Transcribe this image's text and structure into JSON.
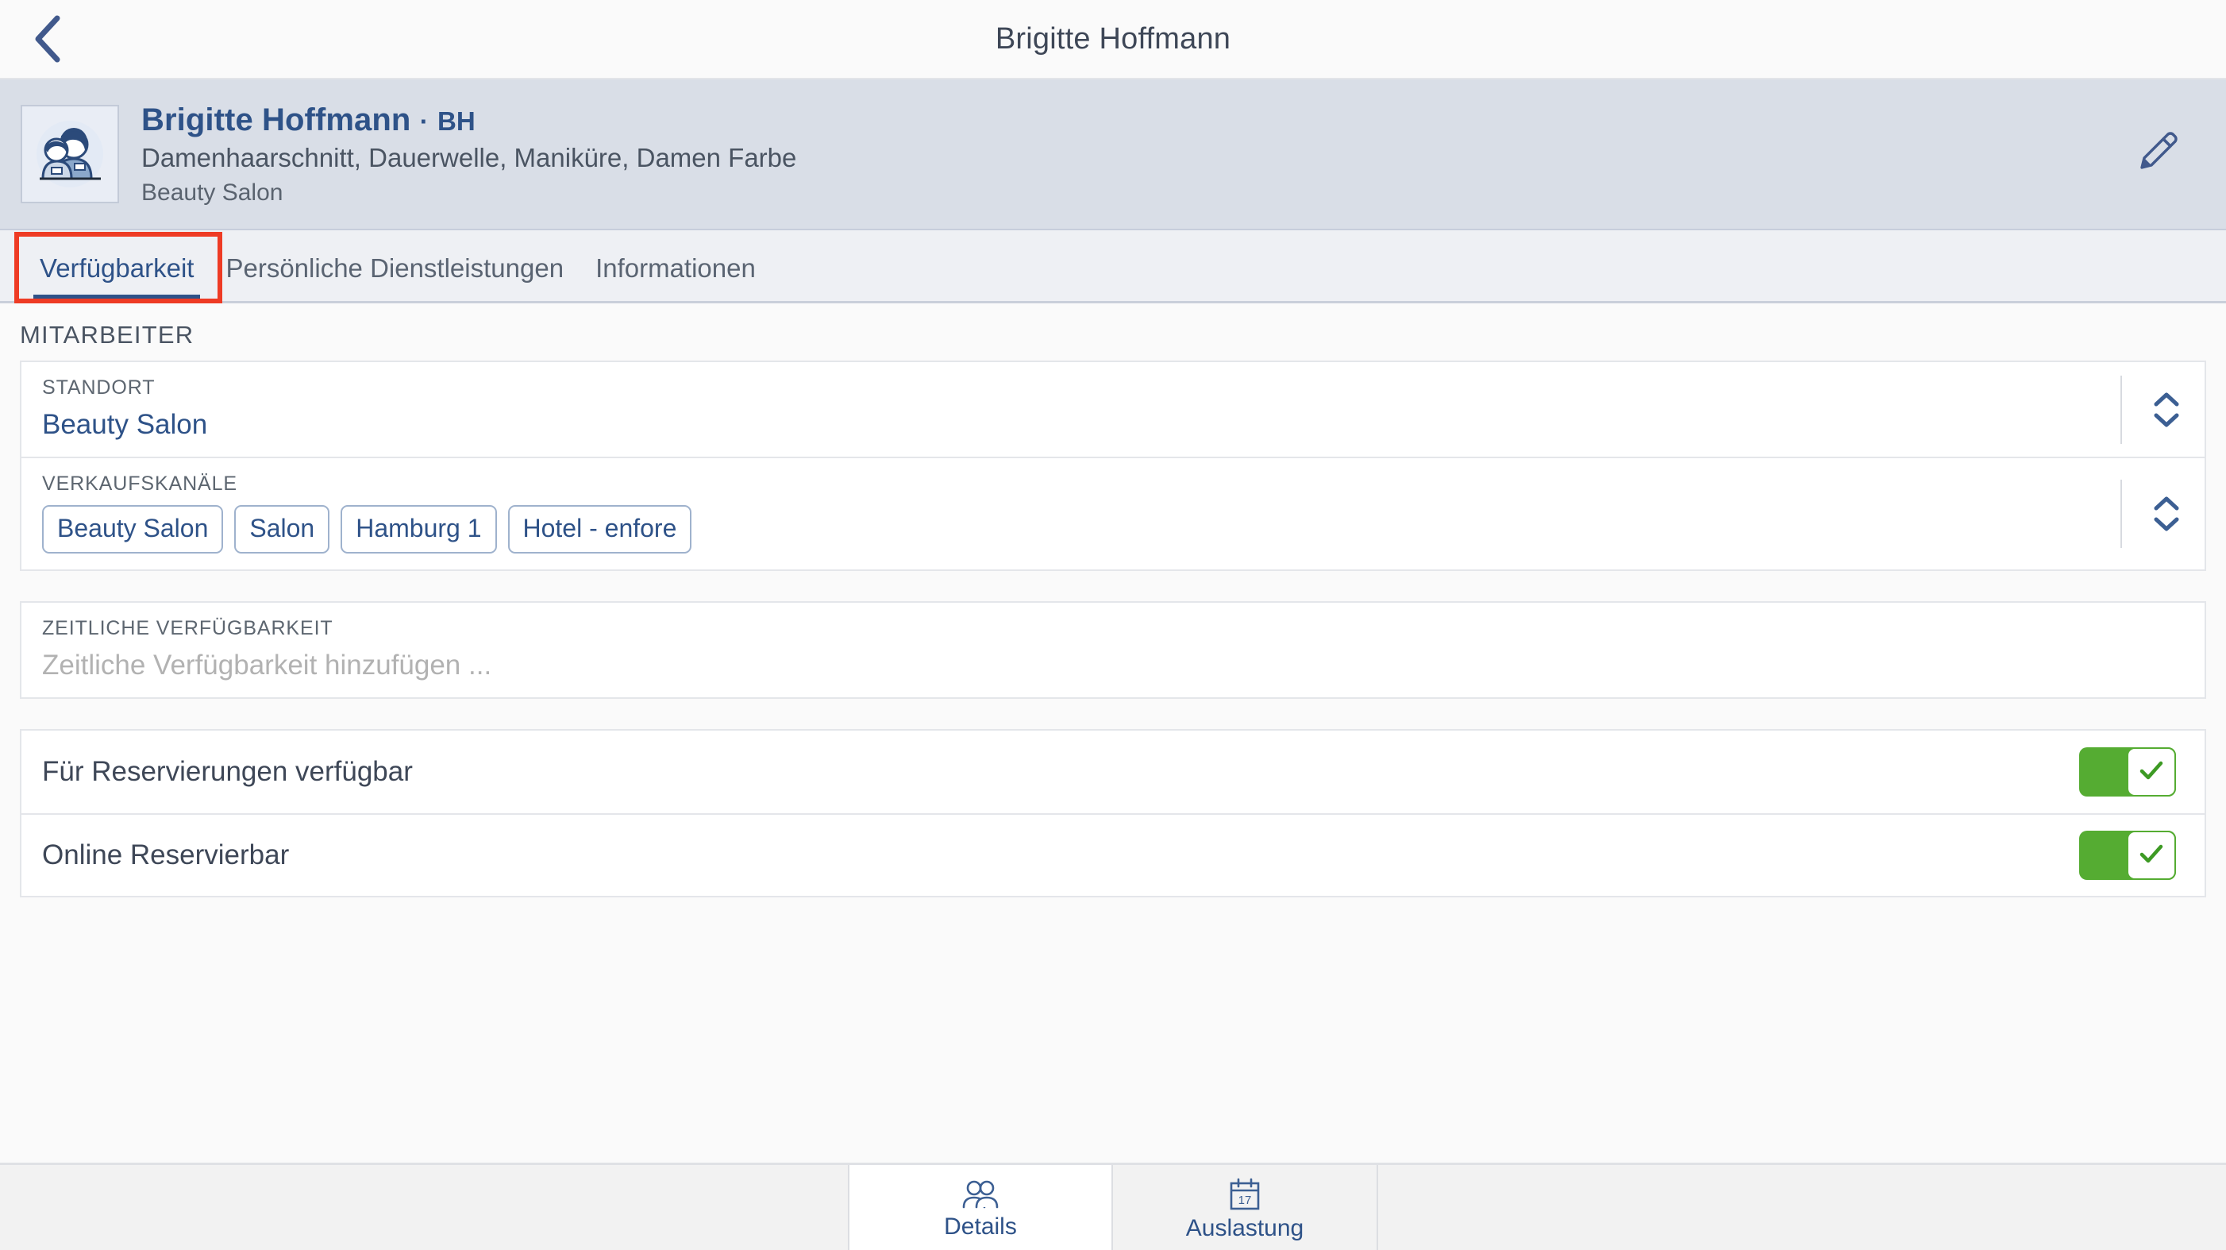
{
  "titlebar": {
    "back_icon": "chevron-left-icon",
    "title": "Brigitte Hoffmann"
  },
  "profile": {
    "avatar_icon": "two-people-avatar-icon",
    "name": "Brigitte Hoffmann",
    "separator": "·",
    "initials": "BH",
    "services": "Damenhaarschnitt, Dauerwelle, Maniküre, Damen Farbe",
    "location": "Beauty Salon",
    "edit_icon": "pencil-edit-icon"
  },
  "tabs": [
    {
      "label": "Verfügbarkeit",
      "active": true,
      "highlighted": true
    },
    {
      "label": "Persönliche Dienstleistungen",
      "active": false,
      "highlighted": false
    },
    {
      "label": "Informationen",
      "active": false,
      "highlighted": false
    }
  ],
  "main": {
    "section_title": "MITARBEITER",
    "standort": {
      "label": "STANDORT",
      "value": "Beauty Salon",
      "stepper_icon": "chevron-up-down-icon"
    },
    "verkaufskanaele": {
      "label": "VERKAUFSKANÄLE",
      "tags": [
        "Beauty Salon",
        "Salon",
        "Hamburg 1",
        "Hotel - enfore"
      ],
      "stepper_icon": "chevron-up-down-icon"
    },
    "zeitliche_verfuegbarkeit": {
      "label": "ZEITLICHE VERFÜGBARKEIT",
      "placeholder": "Zeitliche Verfügbarkeit hinzufügen ..."
    },
    "toggles": [
      {
        "label": "Für Reservierungen verfügbar",
        "on": true,
        "knob_icon": "check-icon"
      },
      {
        "label": "Online Reservierbar",
        "on": true,
        "knob_icon": "check-icon"
      }
    ]
  },
  "bottomnav": [
    {
      "label": "Details",
      "icon": "people-icon",
      "active": true
    },
    {
      "label": "Auslastung",
      "icon": "calendar-17-icon",
      "active": false
    }
  ],
  "colors": {
    "accent_blue": "#2e5288",
    "header_band": "#d9dee7",
    "tabbar_bg": "#eef0f4",
    "highlight_red": "#ee3b24",
    "toggle_green": "#55ac32",
    "page_bg": "#fafafa"
  }
}
